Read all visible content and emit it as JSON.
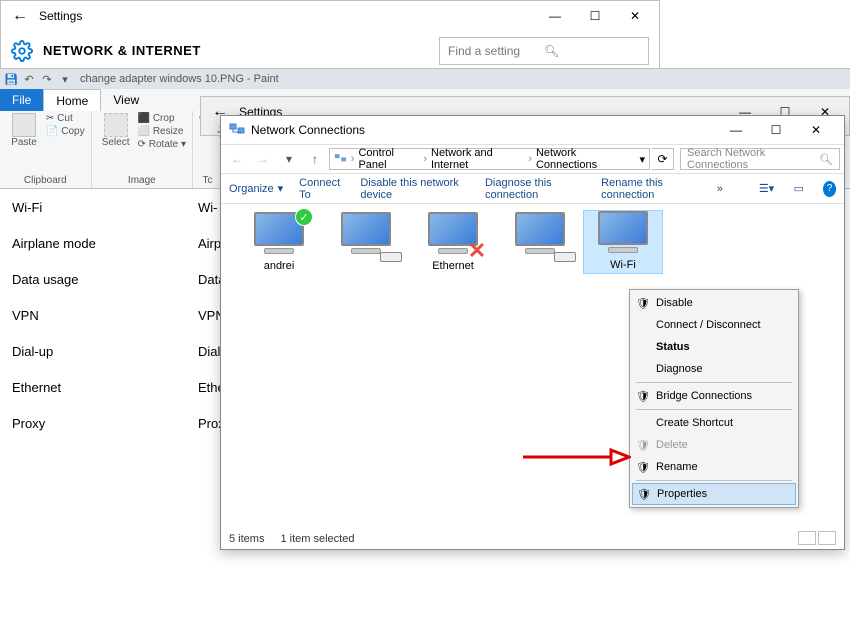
{
  "settings1": {
    "title": "Settings",
    "header": "NETWORK & INTERNET",
    "search_placeholder": "Find a setting",
    "sidebar": [
      "Wi-Fi",
      "Airplane mode",
      "Data usage",
      "VPN",
      "Dial-up",
      "Ethernet",
      "Proxy"
    ],
    "selected_index": 0
  },
  "paint": {
    "qat_title": "change adapter windows 10.PNG - Paint",
    "tabs": {
      "file": "File",
      "home": "Home",
      "view": "View"
    },
    "clipboard": {
      "paste": "Paste",
      "cut": "Cut",
      "copy": "Copy",
      "label": "Clipboard"
    },
    "image": {
      "select": "Select",
      "crop": "Crop",
      "resize": "Resize",
      "rotate": "Rotate",
      "label": "Image"
    },
    "tools_label": "Tc"
  },
  "sidebar_trunc": [
    "Wi-",
    "Airp",
    "Data",
    "VPN",
    "Dial",
    "Ethe",
    "Prox"
  ],
  "settings2": {
    "title": "Settings"
  },
  "nc": {
    "title": "Network Connections",
    "path": [
      "Control Panel",
      "Network and Internet",
      "Network Connections"
    ],
    "search_placeholder": "Search Network Connections",
    "toolbar": {
      "organize": "Organize",
      "connect": "Connect To",
      "disable": "Disable this network device",
      "diagnose": "Diagnose this connection",
      "rename": "Rename this connection"
    },
    "devices": [
      {
        "name": "andrei",
        "status": "ok"
      },
      {
        "name": "",
        "status": "modem"
      },
      {
        "name": "Ethernet",
        "status": "x"
      },
      {
        "name": "",
        "status": "modem"
      },
      {
        "name": "Wi-Fi",
        "status": "sel"
      }
    ],
    "context_menu": [
      {
        "label": "Disable",
        "shield": true
      },
      {
        "label": "Connect / Disconnect"
      },
      {
        "label": "Status",
        "bold": true
      },
      {
        "label": "Diagnose"
      },
      {
        "sep": true
      },
      {
        "label": "Bridge Connections",
        "shield": true
      },
      {
        "sep": true
      },
      {
        "label": "Create Shortcut"
      },
      {
        "label": "Delete",
        "shield": true,
        "disabled": true
      },
      {
        "label": "Rename",
        "shield": true
      },
      {
        "sep": true
      },
      {
        "label": "Properties",
        "shield": true,
        "highlight": true
      }
    ],
    "status": {
      "items": "5 items",
      "selected": "1 item selected"
    }
  }
}
